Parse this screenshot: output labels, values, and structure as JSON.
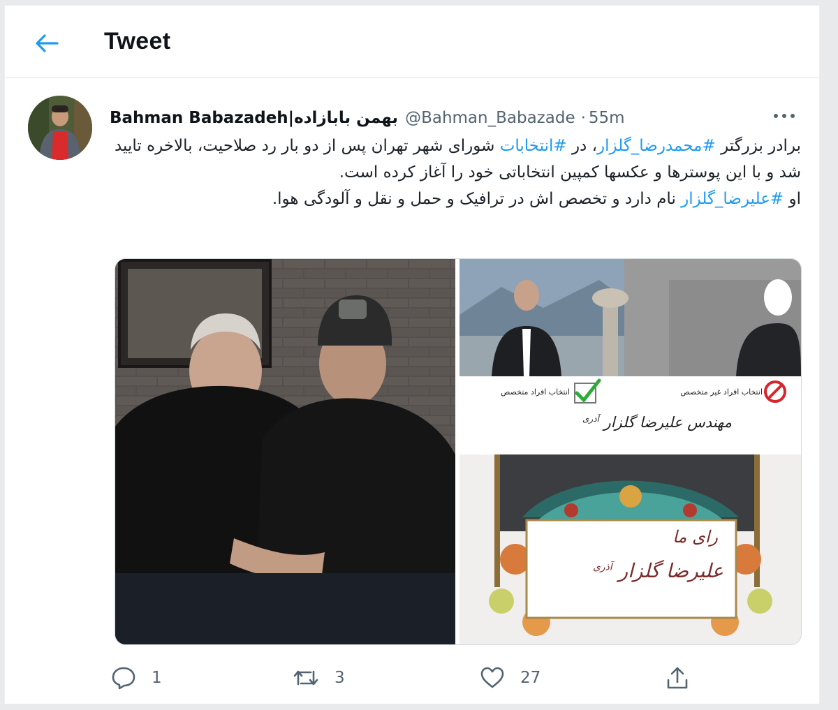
{
  "header": {
    "title": "Tweet"
  },
  "tweet": {
    "author_name": "Bahman Babazadeh|بهمن بابازاده",
    "handle": "@Bahman_Babazade",
    "separator": "·",
    "time": "55m",
    "text": {
      "p1_a": "برادر بزرگتر ",
      "hashtag1": "#محمدرضا_گلزار",
      "p1_b": "، در ",
      "hashtag2": "#انتخابات",
      "p1_c": " شورای شهر تهران پس از دو بار رد صلاحیت، بالاخره تایید شد و با این پوسترها و عکسها کمپین انتخاباتی خود را آغاز کرده است.",
      "p2_a": "او ",
      "hashtag3": "#علیرضا_گلزار",
      "p2_b": " نام دارد و تخصص اش در ترافیک و حمل و نقل و آلودگی هوا."
    },
    "media": {
      "poster_top_left_label": "انتخاب افراد متخصص",
      "poster_top_right_label": "انتخاب افراد غیر متخصص",
      "poster_top_name": "مهندس علیرضا گلزار",
      "poster_top_name_small": "آذری",
      "poster_bottom_heading": "رای ما",
      "poster_bottom_name": "علیرضا گلزار",
      "poster_bottom_name_small": "آذری"
    },
    "actions": {
      "reply_count": "1",
      "retweet_count": "3",
      "like_count": "27"
    }
  },
  "colors": {
    "accent": "#1d9bf0",
    "muted": "#536471",
    "text": "#0f1419"
  },
  "icons": {
    "back": "arrow-left-icon",
    "more": "more-horizontal-icon",
    "reply": "reply-icon",
    "retweet": "retweet-icon",
    "like": "heart-icon",
    "share": "share-icon"
  }
}
